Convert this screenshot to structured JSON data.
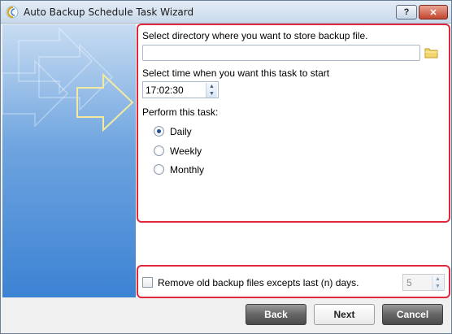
{
  "window": {
    "title": "Auto Backup Schedule Task Wizard",
    "help_label": "?",
    "close_label": "✕"
  },
  "directory": {
    "label": "Select directory where you want to store backup file.",
    "value": ""
  },
  "time": {
    "label": "Select time when you want this task to start",
    "value": "17:02:30"
  },
  "task": {
    "label": "Perform this task:",
    "options": [
      "Daily",
      "Weekly",
      "Monthly"
    ],
    "selected": "Daily"
  },
  "cleanup": {
    "label": "Remove old backup files excepts last (n) days.",
    "checked": false,
    "days_value": "5"
  },
  "buttons": {
    "back": "Back",
    "next": "Next",
    "cancel": "Cancel"
  },
  "colors": {
    "highlight_border": "#e0283c",
    "panel_blue": "#3c82d3"
  }
}
